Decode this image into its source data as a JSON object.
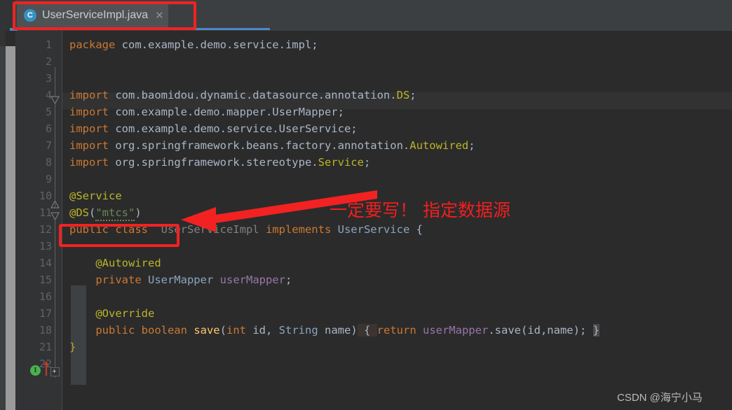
{
  "window": {
    "theme_bg": "#2b2b2b",
    "accent": "#4a88c7",
    "annotation_color": "#f22222"
  },
  "tab": {
    "file_icon_letter": "C",
    "label": "UserServiceImpl.java",
    "close_label": "✕"
  },
  "gutter": {
    "line_numbers": [
      "1",
      "2",
      "3",
      "4",
      "5",
      "6",
      "7",
      "8",
      "9",
      "10",
      "11",
      "12",
      "13",
      "14",
      "15",
      "16",
      "17",
      "18",
      "21",
      "22"
    ],
    "impl_marker_letter": "I",
    "impl_marker_line": "18"
  },
  "code": {
    "lines": [
      {
        "n": "1",
        "tokens": [
          {
            "t": "package",
            "c": "kw"
          },
          {
            "t": " com.example.demo.service.impl;",
            "c": "id"
          }
        ]
      },
      {
        "n": "2",
        "tokens": []
      },
      {
        "n": "3",
        "tokens": []
      },
      {
        "n": "4",
        "tokens": [
          {
            "t": "import",
            "c": "kw"
          },
          {
            "t": " com.baomidou.dynamic.datasource.annotation.",
            "c": "id"
          },
          {
            "t": "DS",
            "c": "ann"
          },
          {
            "t": ";",
            "c": "id"
          }
        ]
      },
      {
        "n": "5",
        "tokens": [
          {
            "t": "import",
            "c": "kw"
          },
          {
            "t": " com.example.demo.mapper.UserMapper;",
            "c": "id"
          }
        ]
      },
      {
        "n": "6",
        "tokens": [
          {
            "t": "import",
            "c": "kw"
          },
          {
            "t": " com.example.demo.service.UserService;",
            "c": "id"
          }
        ]
      },
      {
        "n": "7",
        "tokens": [
          {
            "t": "import",
            "c": "kw"
          },
          {
            "t": " org.springframework.beans.factory.annotation.",
            "c": "id"
          },
          {
            "t": "Autowired",
            "c": "ann"
          },
          {
            "t": ";",
            "c": "id"
          }
        ]
      },
      {
        "n": "8",
        "tokens": [
          {
            "t": "import",
            "c": "kw"
          },
          {
            "t": " org.springframework.stereotype.",
            "c": "id"
          },
          {
            "t": "Service",
            "c": "ann"
          },
          {
            "t": ";",
            "c": "id"
          }
        ]
      },
      {
        "n": "9",
        "tokens": []
      },
      {
        "n": "10",
        "tokens": [
          {
            "t": "@Service",
            "c": "ann"
          }
        ]
      },
      {
        "n": "11",
        "tokens": [
          {
            "t": "@DS",
            "c": "ann"
          },
          {
            "t": "(",
            "c": "id"
          },
          {
            "t": "\"mtcs\"",
            "c": "str squig"
          },
          {
            "t": ")",
            "c": "id"
          }
        ]
      },
      {
        "n": "12",
        "tokens": [
          {
            "t": "public class ",
            "c": "kw"
          },
          {
            "t": " UserServiceImpl",
            "c": "gray"
          },
          {
            "t": " implements ",
            "c": "kw"
          },
          {
            "t": "UserService",
            "c": "type"
          },
          {
            "t": " {",
            "c": "id"
          }
        ]
      },
      {
        "n": "13",
        "tokens": []
      },
      {
        "n": "14",
        "tokens": [
          {
            "t": "    @Autowired",
            "c": "ann"
          }
        ]
      },
      {
        "n": "15",
        "tokens": [
          {
            "t": "    private ",
            "c": "kw"
          },
          {
            "t": "UserMapper",
            "c": "type"
          },
          {
            "t": " ",
            "c": "id"
          },
          {
            "t": "userMapper",
            "c": "fld"
          },
          {
            "t": ";",
            "c": "id"
          }
        ]
      },
      {
        "n": "16",
        "tokens": []
      },
      {
        "n": "17",
        "tokens": [
          {
            "t": "    @Override",
            "c": "ann"
          }
        ]
      },
      {
        "n": "18",
        "tokens": [
          {
            "t": "    public boolean ",
            "c": "kw"
          },
          {
            "t": "save",
            "c": "mth"
          },
          {
            "t": "(",
            "c": "id"
          },
          {
            "t": "int",
            "c": "kw"
          },
          {
            "t": " id, ",
            "c": "id"
          },
          {
            "t": "String",
            "c": "type"
          },
          {
            "t": " name)",
            "c": "id"
          },
          {
            "t": " { ",
            "c": "bhl"
          },
          {
            "t": "return ",
            "c": "kw"
          },
          {
            "t": "userMapper",
            "c": "fld"
          },
          {
            "t": ".",
            "c": "id"
          },
          {
            "t": "save",
            "c": "id"
          },
          {
            "t": "(id,name); ",
            "c": "id"
          },
          {
            "t": "}",
            "c": "bhl2"
          }
        ]
      },
      {
        "n": "21",
        "tokens": [
          {
            "t": "}",
            "c": "ybrace"
          }
        ]
      },
      {
        "n": "22",
        "tokens": []
      }
    ]
  },
  "annotations": {
    "chinese_note": "一定要写！ 指定数据源",
    "watermark": "CSDN @海宁小马"
  }
}
